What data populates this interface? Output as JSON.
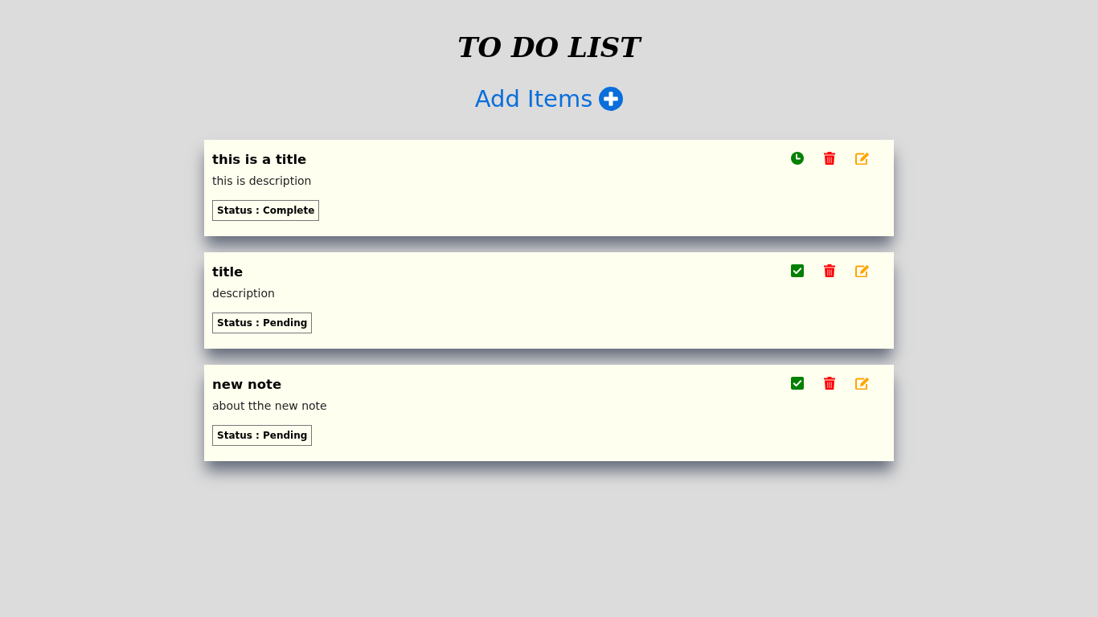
{
  "heading": "TO DO LIST",
  "add_button": {
    "label": "Add Items"
  },
  "items": [
    {
      "title": "this is a title",
      "description": "this is description",
      "status": "Status : Complete",
      "completed": true
    },
    {
      "title": "title",
      "description": "description",
      "status": "Status : Pending",
      "completed": false
    },
    {
      "title": "new note",
      "description": "about tthe new note",
      "status": "Status : Pending",
      "completed": false
    }
  ]
}
